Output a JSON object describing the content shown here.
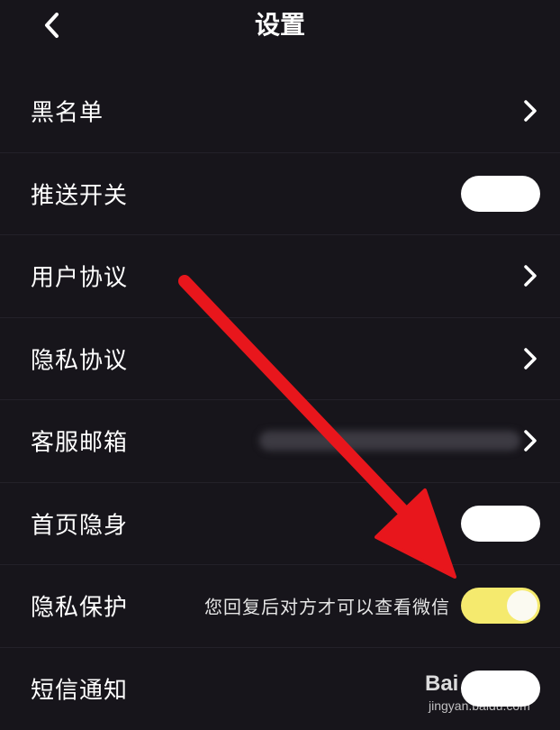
{
  "header": {
    "title": "设置",
    "back_icon": "chevron-left-icon"
  },
  "settings": [
    {
      "label": "黑名单",
      "control": "chevron"
    },
    {
      "label": "推送开关",
      "control": "toggle",
      "state": "off"
    },
    {
      "label": "用户协议",
      "control": "chevron"
    },
    {
      "label": "隐私协议",
      "control": "chevron"
    },
    {
      "label": "客服邮箱",
      "control": "chevron",
      "value_blurred": true
    },
    {
      "label": "首页隐身",
      "control": "toggle",
      "state": "off"
    },
    {
      "label": "隐私保护",
      "control": "toggle",
      "state": "on",
      "hint": "您回复后对方才可以查看微信"
    },
    {
      "label": "短信通知",
      "control": "toggle",
      "state": "off"
    }
  ],
  "annotation": {
    "type": "red-arrow",
    "color": "#e8161c"
  },
  "watermark": {
    "text": "Baidu 经验",
    "subtext": "jingyan.baidu.com"
  },
  "colors": {
    "background": "#17151b",
    "toggle_on": "#f5ea6e",
    "toggle_off": "#ffffff"
  }
}
